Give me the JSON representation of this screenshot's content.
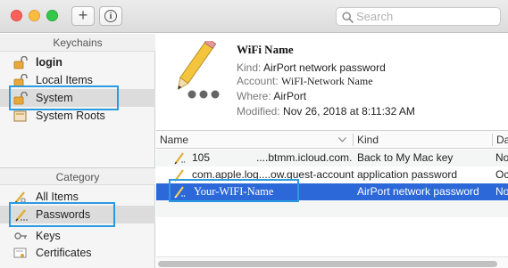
{
  "toolbar": {
    "add_label": "+",
    "info_label": "i",
    "search_placeholder": "Search"
  },
  "sidebar": {
    "keychains_header": "Keychains",
    "keychains": [
      {
        "label": "login",
        "icon": "lock-open-icon"
      },
      {
        "label": "Local Items",
        "icon": "lock-open-icon"
      },
      {
        "label": "System",
        "icon": "lock-open-icon",
        "selected": true
      },
      {
        "label": "System Roots",
        "icon": "folder-icon"
      }
    ],
    "category_header": "Category",
    "categories": [
      {
        "label": "All Items",
        "icon": "key-pencil-icon"
      },
      {
        "label": "Passwords",
        "icon": "pencil-icon",
        "selected": true
      },
      {
        "label": "Keys",
        "icon": "key-icon"
      },
      {
        "label": "Certificates",
        "icon": "certificate-icon"
      }
    ]
  },
  "detail": {
    "title": "WiFi Name",
    "kind_label": "Kind:",
    "kind_value": "AirPort network password",
    "account_label": "Account:",
    "account_value": "WiFI-Network Name",
    "where_label": "Where:",
    "where_value": "AirPort",
    "modified_label": "Modified:",
    "modified_value": "Nov 26, 2018 at 8:11:32 AM"
  },
  "table": {
    "columns": [
      "Name",
      "Kind",
      "Da"
    ],
    "rows": [
      {
        "name_prefix": "105",
        "name_suffix": "....btmm.icloud.com.",
        "kind": "Back to My Mac key",
        "date": "No"
      },
      {
        "name_prefix": "com.apple.log....ow.guest-account",
        "name_suffix": "",
        "kind": "application password",
        "date": "Oc"
      },
      {
        "name_prefix": "Your-WIFI-Name",
        "name_suffix": "",
        "kind": "AirPort network password",
        "date": "No",
        "selected": true
      }
    ]
  },
  "colors": {
    "highlight": "#2a9be0",
    "selection": "#2c68d8"
  }
}
